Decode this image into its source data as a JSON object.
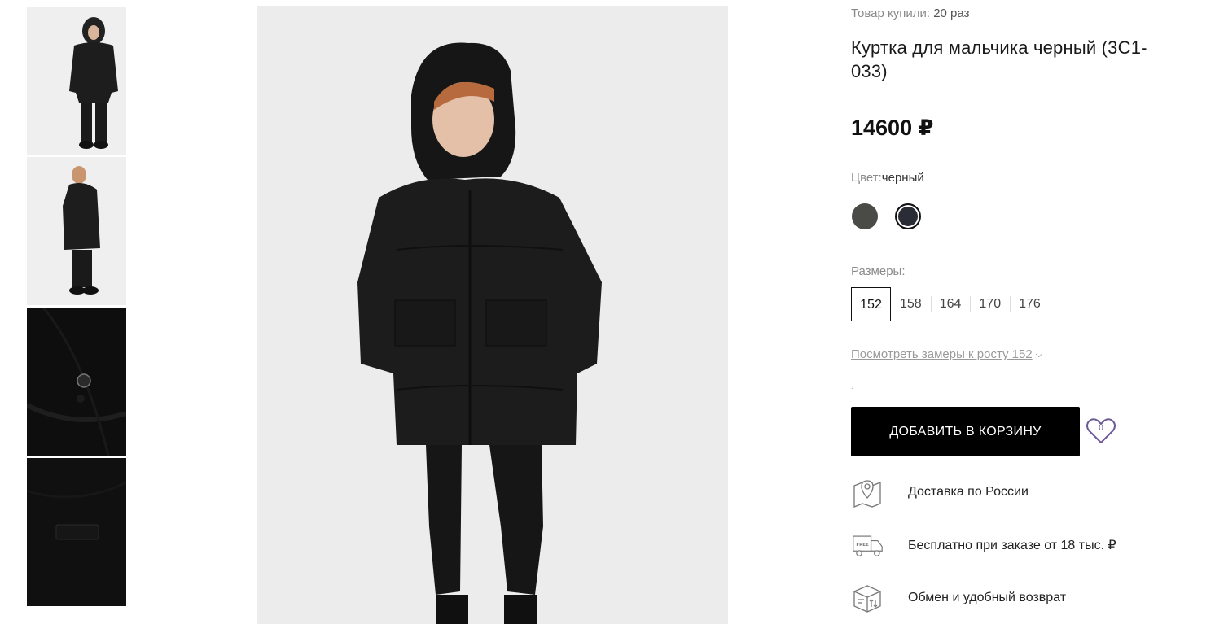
{
  "thumbnails": [
    {
      "icon": "photo-front"
    },
    {
      "icon": "photo-side"
    },
    {
      "icon": "photo-detail-zipper"
    },
    {
      "icon": "photo-detail-label"
    }
  ],
  "product": {
    "purchased_label": "Товар купили:",
    "purchased_count": "20 раз",
    "title": "Куртка для мальчика черный (3С1-033)",
    "price": "14600 ₽",
    "color_label": "Цвет:",
    "color_value": "черный",
    "colors": [
      "#4a4a46",
      "#2a2d36"
    ],
    "sizes_label": "Размеры:",
    "sizes": [
      "152",
      "158",
      "164",
      "170",
      "176"
    ],
    "selected_size": "152",
    "measurements_link": "Посмотреть замеры к росту 152",
    "add_to_cart": "ДОБАВИТЬ В КОРЗИНУ",
    "favorites_count": "0"
  },
  "features": [
    {
      "icon": "map-pin-icon",
      "text": "Доставка по России"
    },
    {
      "icon": "free-delivery-truck-icon",
      "text": "Бесплатно при заказе от 18 тыс. ₽"
    },
    {
      "icon": "return-box-icon",
      "text": "Обмен и удобный возврат"
    }
  ],
  "colors": {
    "button_bg": "#000000",
    "accent_heart": "#6b5a96",
    "muted_text": "#8a8a8a"
  }
}
